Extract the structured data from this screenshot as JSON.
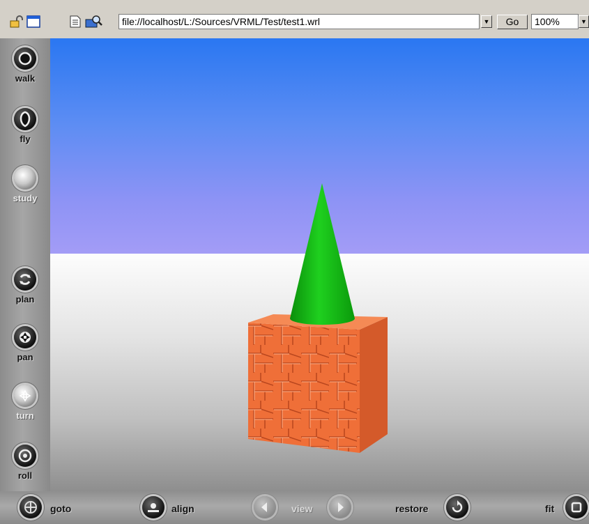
{
  "toolbar": {
    "url": "file://localhost/L:/Sources/VRML/Test/test1.wrl",
    "go_label": "Go",
    "zoom": "100%"
  },
  "nav": {
    "walk": "walk",
    "fly": "fly",
    "study": "study",
    "plan": "plan",
    "pan": "pan",
    "turn": "turn",
    "roll": "roll"
  },
  "bottom": {
    "goto": "goto",
    "align": "align",
    "view": "view",
    "restore": "restore",
    "fit": "fit"
  },
  "scene": {
    "sky_color": "#5d8df3",
    "cone_color": "#12b812",
    "cube_color": "#f0703a"
  }
}
